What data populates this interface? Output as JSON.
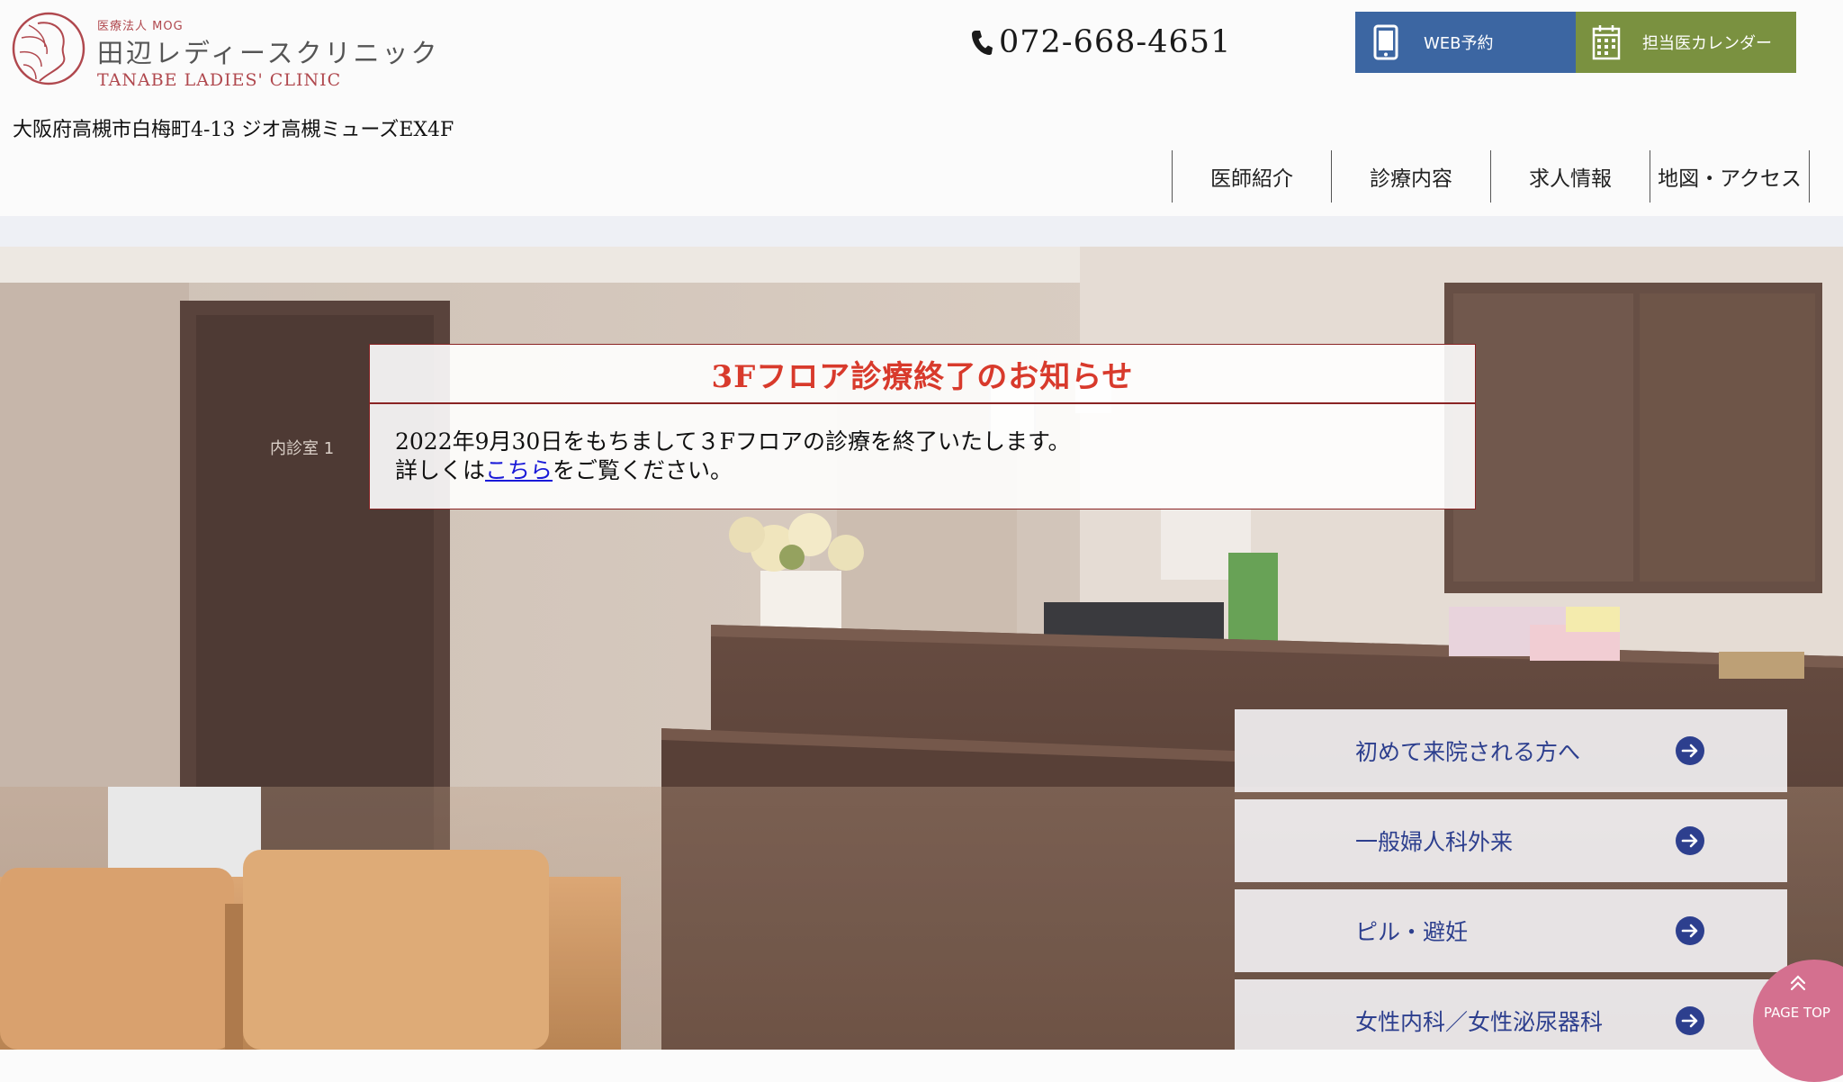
{
  "header": {
    "logo": {
      "corp_name": "医療法人 MOG",
      "name_jp": "田辺レディースクリニック",
      "name_en": "TANABE LADIES' CLINIC"
    },
    "address": "大阪府高槻市白梅町4-13 ジオ高槻ミューズEX4F",
    "phone": "072-668-4651",
    "buttons": {
      "web_booking": "WEB予約",
      "calendar": "担当医カレンダー"
    },
    "nav": [
      {
        "label": "医師紹介"
      },
      {
        "label": "診療内容"
      },
      {
        "label": "求人情報"
      },
      {
        "label": "地図・アクセス"
      }
    ]
  },
  "notice": {
    "title": "3Fフロア診療終了のお知らせ",
    "line1": "2022年9月30日をもちまして３Fフロアの診療を終了いたします。",
    "line2_prefix": "詳しくは",
    "line2_link": "こちら",
    "line2_suffix": "をご覧ください。"
  },
  "side_menu": [
    {
      "label": "初めて来院される方へ"
    },
    {
      "label": "一般婦人科外来"
    },
    {
      "label": "ピル・避妊"
    },
    {
      "label": "女性内科／女性泌尿器科"
    }
  ],
  "page_top": {
    "label": "PAGE TOP"
  },
  "icons": {
    "phone": "phone-icon",
    "web_booking": "tablet-icon",
    "calendar": "calendar-icon",
    "menu_arrow": "arrow-right-circle-icon",
    "page_top": "chevron-up-icon"
  },
  "colors": {
    "brand_red": "#b0484e",
    "web_button": "#3c66a2",
    "calendar_button": "#7a9140",
    "notice_title": "#d83a2c",
    "menu_text": "#2d3f8e",
    "page_top": "#d4708f"
  }
}
